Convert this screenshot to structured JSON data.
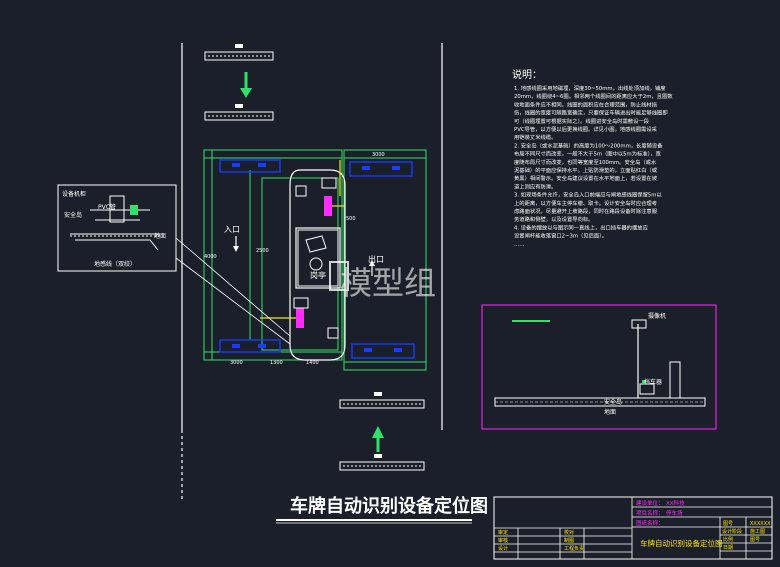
{
  "watermark": "模型组",
  "main_title": "车牌自动识别设备定位图",
  "notes": {
    "title": "说明：",
    "lines": [
      "1. 地感线圈采用地磁埋，深度30~50mm，出线处须加线，铺度",
      "20mm，线圈绕4~6圈。相邻两个线圈间的距离应大于2m，且圈数",
      "收地面条件应不相同。线圈的面积应在合理范围，防止线材损",
      "伤，线圈的宽度可随路宽确定，只要保证车辆进出时能足够线圈即",
      "可（线圈埋置可根据实际之）。线圈进安全岛时需敷设一段",
      "PVC导管，以方便以后更换线圈。详见小图。地感线圈需设采",
      "用铠装丈米线缆。",
      "2. 安全岛（或水泥基础）的高度为100～200mm，长度随设备",
      "布局不同尺寸而改变，一般不大于5m（图中以5m为标准），宽",
      "度随布局尺寸而改变，也同等宽度至100mm。安全岛（或水",
      "泥基础）的平面应保持水平。上贴防滑垫的，立面贴红白（或",
      "黄黑）相间警示。安全岛建议设置在水平地面上，若设置在坡",
      "道上则应有防滑。",
      "3. 如现场条件允许，安全岛入口前端应与闸地感线圈保留5m以",
      "上的距离，以方便车主停车缴、取卡。设计安全岛时应合理考",
      "虑路面状况，尽量避开上坡路段，同时在路段设备时除注意服",
      "务道路和侧壁，以及设置导向标。",
      "4. 设备的摆放以与图示同一直线上，出口挡车器的摆放应",
      "设置闸杆能收落窗口2~3m（见后面）。",
      "……"
    ]
  },
  "left_detail": {
    "labels": {
      "top": "设备机柜",
      "pvc": "PVC管",
      "island": "安全岛",
      "ground": "地面",
      "loop": "地感线（双绞）"
    }
  },
  "plan": {
    "booth": "岗亭",
    "enter_label": "入口",
    "exit_label": "出口",
    "dim_labels": [
      "3000",
      "1300",
      "1400",
      "3000",
      "500",
      "2500",
      "4000"
    ]
  },
  "section": {
    "camera": "摄像机",
    "barrier": "挡车器",
    "island": "安全岛",
    "ground": "地面"
  },
  "title_block": {
    "right_rows": [
      [
        "建设单位：",
        "XX科技"
      ],
      [
        "项目名称：",
        "停车场"
      ],
      [
        "图纸名称：",
        ""
      ]
    ],
    "bottom_title": "车牌自动识别设备定位图",
    "grid_labels": [
      "图号",
      "设计阶段",
      "施工图",
      "比例",
      "图号",
      "日期",
      "审定",
      "审核",
      "设计",
      "校对",
      "制图",
      "工程负责"
    ],
    "drawing_no": "XXXXXX"
  },
  "colors": {
    "bg": "#1b1f29",
    "line": "#ffffff",
    "green": "#2fe06a",
    "blue": "#1a3cff",
    "magenta": "#ff2bff",
    "yellow": "#ffe600",
    "cyan": "#3ae7ff"
  }
}
